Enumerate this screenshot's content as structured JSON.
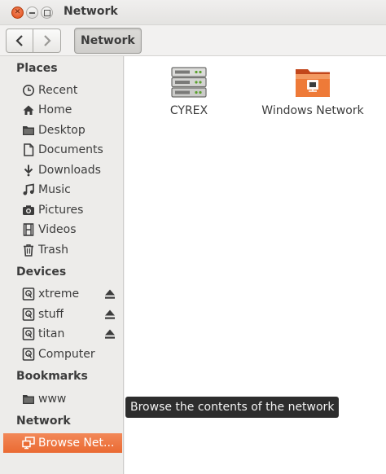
{
  "window": {
    "title": "Network"
  },
  "toolbar": {
    "path_button": "Network"
  },
  "sidebar": {
    "places_header": "Places",
    "places": [
      {
        "label": "Recent",
        "icon": "clock-icon"
      },
      {
        "label": "Home",
        "icon": "home-icon"
      },
      {
        "label": "Desktop",
        "icon": "folder-icon"
      },
      {
        "label": "Documents",
        "icon": "document-icon"
      },
      {
        "label": "Downloads",
        "icon": "download-icon"
      },
      {
        "label": "Music",
        "icon": "music-icon"
      },
      {
        "label": "Pictures",
        "icon": "camera-icon"
      },
      {
        "label": "Videos",
        "icon": "film-icon"
      },
      {
        "label": "Trash",
        "icon": "trash-icon"
      }
    ],
    "devices_header": "Devices",
    "devices": [
      {
        "label": "xtreme",
        "icon": "drive-icon",
        "ejectable": true
      },
      {
        "label": "stuff",
        "icon": "drive-icon",
        "ejectable": true
      },
      {
        "label": "titan",
        "icon": "drive-icon",
        "ejectable": true
      },
      {
        "label": "Computer",
        "icon": "drive-icon",
        "ejectable": false
      }
    ],
    "bookmarks_header": "Bookmarks",
    "bookmarks": [
      {
        "label": "www",
        "icon": "folder-icon"
      }
    ],
    "network_header": "Network",
    "network": [
      {
        "label": "Browse Net...",
        "icon": "network-icon",
        "selected": true
      }
    ]
  },
  "main": {
    "items": [
      {
        "label": "CYREX",
        "icon": "server-icon"
      },
      {
        "label": "Windows Network",
        "icon": "network-folder-icon"
      }
    ]
  },
  "tooltip": {
    "text": "Browse the contents of the network"
  },
  "colors": {
    "accent": "#ea6a32",
    "close_button": "#df4a16",
    "tooltip_bg": "#2d2d2d"
  }
}
